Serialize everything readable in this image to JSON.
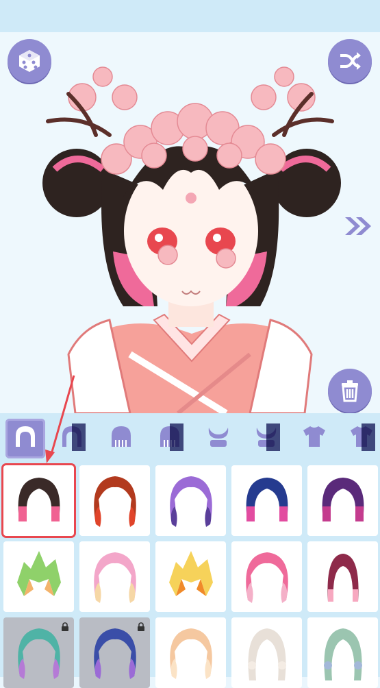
{
  "header": {},
  "controls": {
    "random_icon": "dice-icon",
    "shuffle_icon": "shuffle-icon",
    "next_icon": "double-chevron-right-icon",
    "trash_icon": "trash-icon"
  },
  "colors": {
    "accent": "#8f8bd1",
    "panel": "#cfeaf8",
    "highlight": "#e8474f"
  },
  "tabs": [
    {
      "icon": "hair-front-icon",
      "active": true
    },
    {
      "icon": "hair-front-half-icon",
      "active": false
    },
    {
      "icon": "hair-back-icon",
      "active": false
    },
    {
      "icon": "hair-back-half-icon",
      "active": false
    },
    {
      "icon": "horns-icon",
      "active": false
    },
    {
      "icon": "horns-half-icon",
      "active": false
    },
    {
      "icon": "shirt-icon",
      "active": false
    },
    {
      "icon": "shirt-half-icon",
      "active": false
    }
  ],
  "hair_options": [
    {
      "colors": [
        "#3a2a28",
        "#f06292"
      ],
      "style": "short",
      "locked": false,
      "selected": true
    },
    {
      "colors": [
        "#b23a1e",
        "#e0442a"
      ],
      "style": "wavy",
      "locked": false,
      "selected": false
    },
    {
      "colors": [
        "#9b6bd6",
        "#5a3f9a"
      ],
      "style": "curl",
      "locked": false,
      "selected": false
    },
    {
      "colors": [
        "#253b8f",
        "#e24ca0"
      ],
      "style": "bob",
      "locked": false,
      "selected": false
    },
    {
      "colors": [
        "#5a2a7a",
        "#c43c8e"
      ],
      "style": "bob",
      "locked": false,
      "selected": false
    },
    {
      "colors": [
        "#8fd16a",
        "#f3b36b"
      ],
      "style": "messy",
      "locked": false,
      "selected": false
    },
    {
      "colors": [
        "#f3a6c9",
        "#f6d7a6"
      ],
      "style": "long",
      "locked": false,
      "selected": false
    },
    {
      "colors": [
        "#f6d25a",
        "#f08a2a"
      ],
      "style": "spiky",
      "locked": false,
      "selected": false
    },
    {
      "colors": [
        "#ef6a9a",
        "#f4b0c8"
      ],
      "style": "wavy",
      "locked": false,
      "selected": false
    },
    {
      "colors": [
        "#8e2a4a",
        "#f7a8c0"
      ],
      "style": "straight",
      "locked": false,
      "selected": false
    },
    {
      "colors": [
        "#4fb3a6",
        "#b57ad6"
      ],
      "style": "curl",
      "locked": true,
      "selected": false
    },
    {
      "colors": [
        "#3a4ea8",
        "#9b6bd6"
      ],
      "style": "curl",
      "locked": true,
      "selected": false
    },
    {
      "colors": [
        "#f5c8a0",
        "#fbe3c6"
      ],
      "style": "long",
      "locked": false,
      "selected": false
    },
    {
      "colors": [
        "#e8e0d8",
        "#f4ece4"
      ],
      "style": "braid",
      "locked": false,
      "selected": false
    },
    {
      "colors": [
        "#9bc5b0",
        "#a3b8d8"
      ],
      "style": "braid",
      "locked": false,
      "selected": false
    }
  ]
}
